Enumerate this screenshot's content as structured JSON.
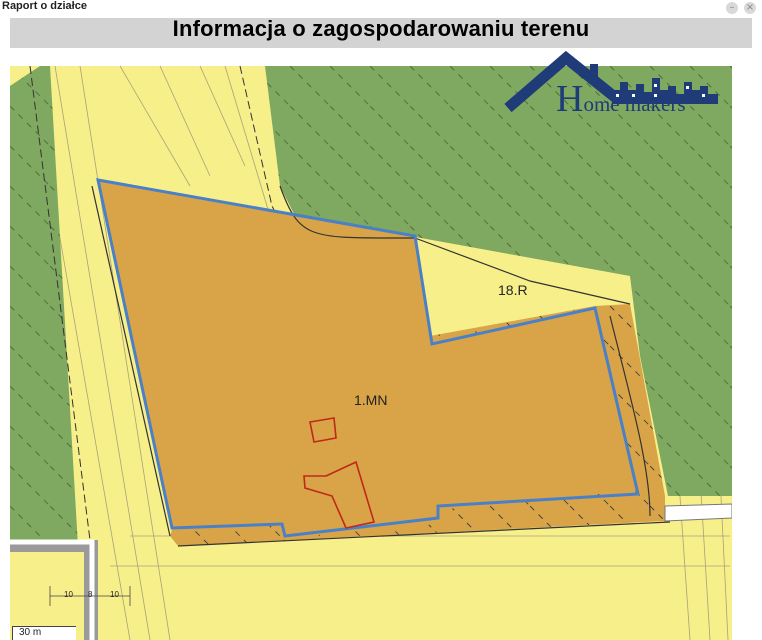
{
  "window": {
    "title": "Raport o działce",
    "minimize_icon": "minimize-icon",
    "close_icon": "close-icon"
  },
  "header": {
    "title": "Informacja o zagospodarowaniu terenu"
  },
  "logo": {
    "initial": "H",
    "rest": "ome makers",
    "icon": "house-skyline-logo"
  },
  "map": {
    "labels": {
      "main": "1.MN",
      "road": "18.R",
      "dim_a": "10",
      "dim_b": "8",
      "dim_c": "10"
    },
    "scale": "30 m",
    "colors": {
      "base": "#f7ef8a",
      "forest": "#7fa860",
      "plot": "#d8a447",
      "boundary": "#4a80c8",
      "building": "#c0281a",
      "road": "#9a9a9a"
    }
  }
}
